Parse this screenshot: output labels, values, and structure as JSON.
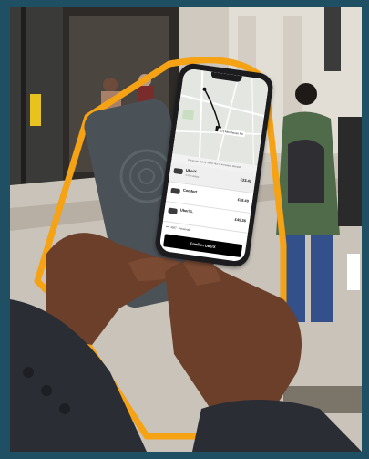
{
  "colors": {
    "frame": "#1e4f63",
    "accent_outline": "#f5a314",
    "powerbank": "#4a5157",
    "phone_body": "#1c1c1e",
    "skin": "#6b3f2a",
    "jacket": "#2a2d33",
    "pavement": "#c9c3ba"
  },
  "phone_screen": {
    "destination": "372 Moorhouse Rd",
    "banner_text": "Prices are slightly higher due to increased demand",
    "rides": [
      {
        "name": "UberX",
        "capacity": "4",
        "subtitle": "4 min away · ",
        "price": "£23.42"
      },
      {
        "name": "Comfort",
        "capacity": "",
        "subtitle": "",
        "price": "£38.40"
      },
      {
        "name": "UberXL",
        "capacity": "",
        "subtitle": "",
        "price": "£45.36"
      }
    ],
    "payment": "•••• 4567  ·  Personal",
    "confirm_label": "Confirm UberX"
  }
}
